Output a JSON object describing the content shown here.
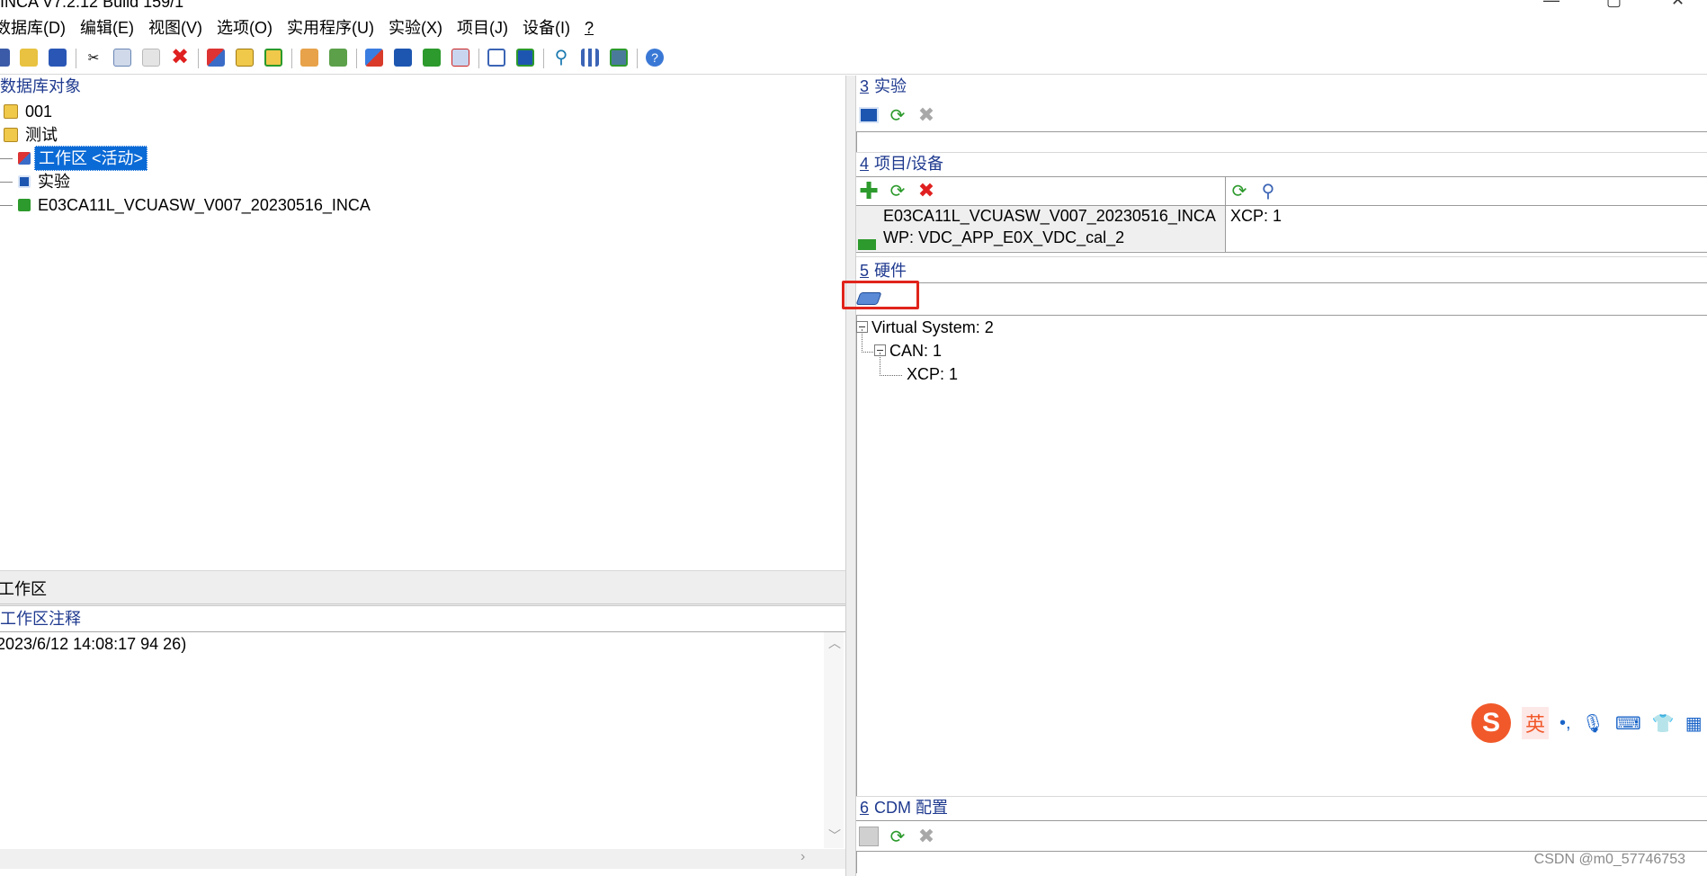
{
  "window": {
    "title": "INCA V7.2.12 Build 159/1",
    "minimize_glyph": "—",
    "maximize_glyph": "▢",
    "close_glyph": "✕"
  },
  "menu": {
    "items": [
      "数据库(D)",
      "编辑(E)",
      "视图(V)",
      "选项(O)",
      "实用程序(U)",
      "实验(X)",
      "项目(J)",
      "设备(I)",
      "?"
    ]
  },
  "toolbar": {
    "icons": [
      "database-icon",
      "open-folder-icon",
      "save-icon",
      "cut-icon",
      "copy-icon",
      "paste-icon",
      "delete-icon",
      "workspace-icon",
      "tree-icon",
      "add-tree-icon",
      "import-icon",
      "export-icon",
      "experiment-icon",
      "calibration-icon",
      "hardware-icon",
      "compare-icon",
      "checklist-icon",
      "configure-icon",
      "search-icon",
      "table-icon",
      "edit-icon",
      "help-icon"
    ]
  },
  "left": {
    "header": "数据库对象",
    "tree": [
      {
        "label": "001",
        "icon": "folder-icon"
      },
      {
        "label": "测试",
        "icon": "folder-icon"
      },
      {
        "label": "工作区 <活动>",
        "icon": "workspace-icon"
      },
      {
        "label": "实验",
        "icon": "experiment-icon"
      },
      {
        "label": "E03CA11L_VCUASW_V007_20230516_INCA",
        "icon": "project-icon"
      }
    ],
    "splitter_title": "工作区",
    "notes_title": "工作区注释",
    "notes_text": "2023/6/12 14:08:17 94 26)"
  },
  "right": {
    "experiment": {
      "num": "3",
      "title": "实验"
    },
    "project": {
      "num": "4",
      "title": "项目/设备",
      "project_name": "E03CA11L_VCUASW_V007_20230516_INCA",
      "working_page": "WP: VDC_APP_E0X_VDC_cal_2",
      "device": "XCP: 1"
    },
    "hardware": {
      "num": "5",
      "title": "硬件",
      "tree": [
        "Virtual System: 2",
        "CAN: 1",
        "XCP: 1"
      ]
    },
    "cdm": {
      "num": "6",
      "title": "CDM 配置"
    }
  },
  "ime": {
    "logo": "S",
    "lang": "英",
    "punct": "•,"
  },
  "watermark": "CSDN @m0_57746753",
  "colors": {
    "selection": "#0a6ad6",
    "section_title": "#1f3a8f",
    "highlight_box": "#e0241b"
  }
}
